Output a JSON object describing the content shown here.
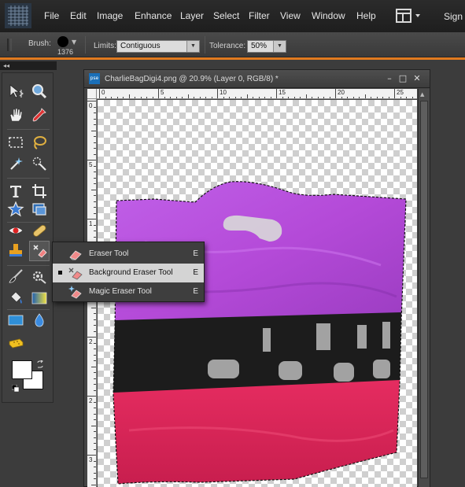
{
  "menu": {
    "items": [
      "File",
      "Edit",
      "Image",
      "Enhance",
      "Layer",
      "Select",
      "Filter",
      "View",
      "Window",
      "Help"
    ],
    "sign_label": "Sign"
  },
  "options": {
    "brush_label": "Brush:",
    "brush_size": "1376",
    "limits_label": "Limits:",
    "limits_value": "Contiguous",
    "tolerance_label": "Tolerance:",
    "tolerance_value": "50%"
  },
  "panel": {
    "collapse_glyph": "◂◂"
  },
  "flyout": {
    "items": [
      {
        "label": "Eraser Tool",
        "shortcut": "E",
        "icon": "eraser-icon",
        "selected": false
      },
      {
        "label": "Background Eraser Tool",
        "shortcut": "E",
        "icon": "background-eraser-icon",
        "selected": true
      },
      {
        "label": "Magic Eraser Tool",
        "shortcut": "E",
        "icon": "magic-eraser-icon",
        "selected": false
      }
    ]
  },
  "document": {
    "badge": "pse",
    "title": "CharlieBagDigi4.png @ 20.9% (Layer 0, RGB/8) *",
    "ruler_top_labels": [
      "0",
      "5",
      "10",
      "15",
      "20",
      "25"
    ],
    "ruler_left_labels": [
      "0",
      "5",
      "1",
      "1",
      "2",
      "2",
      "3"
    ]
  },
  "colors": {
    "accent": "#e07a1f",
    "bag_purple": "#b24ad6",
    "bag_pink": "#d9245a",
    "bag_black": "#1c1c1c"
  }
}
